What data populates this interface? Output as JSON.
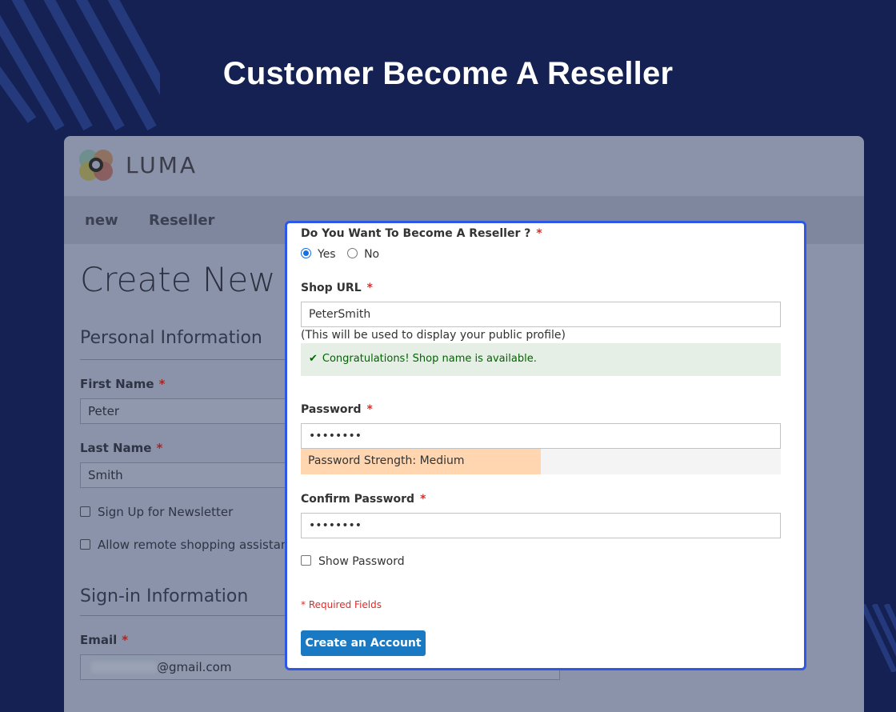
{
  "headline": "Customer Become A Reseller",
  "store": {
    "logo_text": "LUMA",
    "nav": [
      "new",
      "Reseller"
    ],
    "page_title": "Create New Cu",
    "personal_section": "Personal Information",
    "first_name_label": "First Name",
    "first_name_value": "Peter",
    "last_name_label": "Last Name",
    "last_name_value": "Smith",
    "newsletter_label": "Sign Up for Newsletter",
    "remote_assist_label": "Allow remote shopping assistance",
    "signin_section": "Sign-in Information",
    "email_label": "Email",
    "email_value_visible": "@gmail.com",
    "required_star": "*"
  },
  "form": {
    "reseller_question": "Do You Want To Become A Reseller ?",
    "options": [
      {
        "label": "Yes",
        "selected": true
      },
      {
        "label": "No",
        "selected": false
      }
    ],
    "shop_url_label": "Shop URL",
    "shop_url_value": "PeterSmith",
    "shop_url_note": "(This will be used to display your public profile)",
    "success_icon": "check-icon",
    "success_check": "✔",
    "success_message": "Congratulations! Shop name is available.",
    "password_label": "Password",
    "password_value": "••••••••",
    "strength_text": "Password Strength: Medium",
    "strength_fraction": 0.5,
    "confirm_label": "Confirm Password",
    "confirm_value": "••••••••",
    "show_password_label": "Show Password",
    "required_fields": "* Required Fields",
    "submit_label": "Create an Account",
    "required_star": "*"
  },
  "colors": {
    "background": "#142152",
    "panel_border": "#2f57e6",
    "button": "#1979c3",
    "success_bg": "#e5efe5",
    "strength_medium": "#ffd6b0"
  }
}
